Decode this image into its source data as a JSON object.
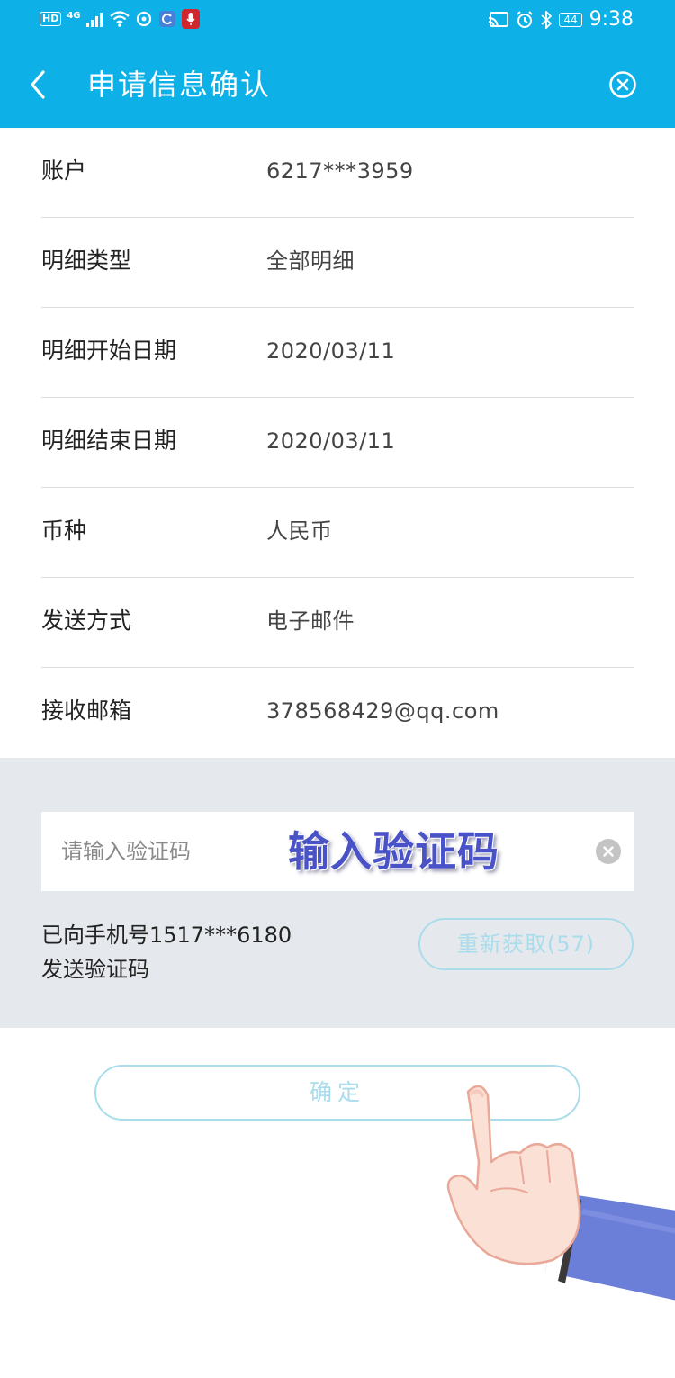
{
  "status_bar": {
    "hd": "HD",
    "network": "4G",
    "battery": "44",
    "time": "9:38",
    "icons": [
      "signal-icon",
      "wifi-icon",
      "sync-icon",
      "mic-icon",
      "cast-icon",
      "alarm-icon",
      "bluetooth-icon",
      "battery-icon"
    ]
  },
  "header": {
    "title": "申请信息确认",
    "back_icon": "chevron-left-icon",
    "close_icon": "close-circle-icon",
    "bg_color": "#0db1e8"
  },
  "details": [
    {
      "label": "账户",
      "value": "6217***3959"
    },
    {
      "label": "明细类型",
      "value": "全部明细"
    },
    {
      "label": "明细开始日期",
      "value": "2020/03/11"
    },
    {
      "label": "明细结束日期",
      "value": "2020/03/11"
    },
    {
      "label": "币种",
      "value": "人民币"
    },
    {
      "label": "发送方式",
      "value": "电子邮件"
    },
    {
      "label": "接收邮箱",
      "value": "378568429@qq.com"
    }
  ],
  "verification": {
    "placeholder": "请输入验证码",
    "value": "",
    "overlay_caption": "输入验证码",
    "sent_line1": "已向手机号1517***6180",
    "sent_line2": "发送验证码",
    "resend_label": "重新获取(57)"
  },
  "confirm": {
    "label": "确定"
  },
  "colors": {
    "accent": "#0db1e8",
    "button_outline": "#a9ddec",
    "panel_gray": "#e5e8ec",
    "overlay_text": "#4a52c8"
  }
}
